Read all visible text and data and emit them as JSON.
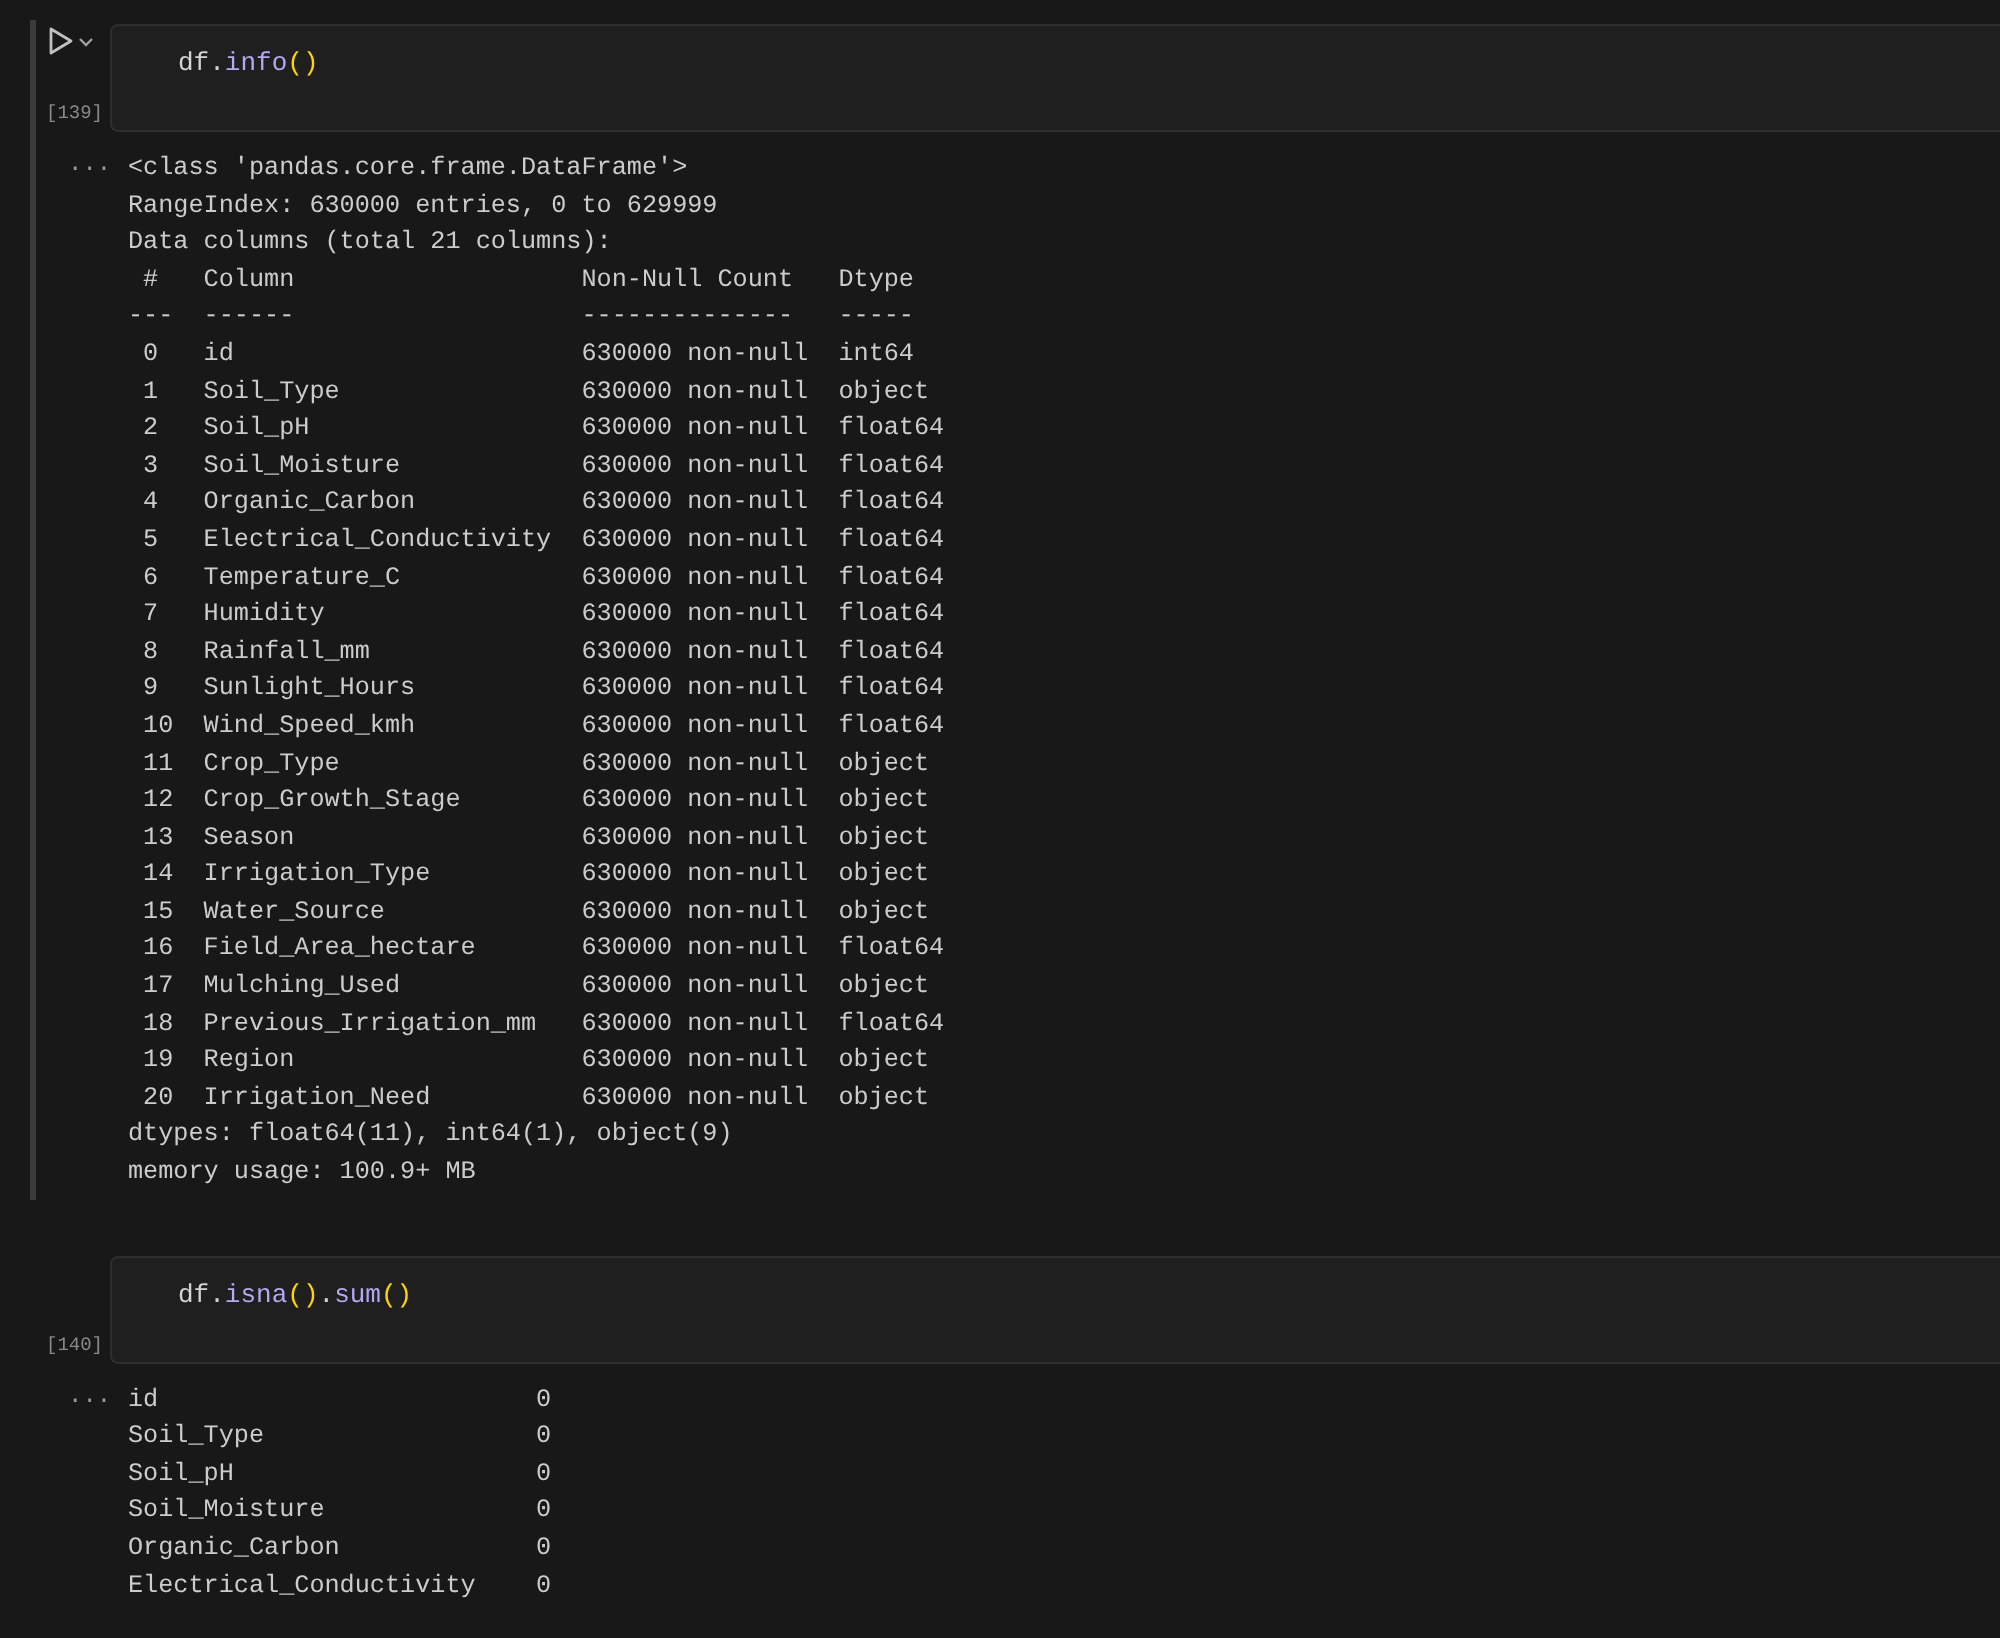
{
  "cells": [
    {
      "selected": true,
      "execution_count": "[139]",
      "code": [
        {
          "text": "df",
          "kind": "variable"
        },
        {
          "text": ".",
          "kind": "plain"
        },
        {
          "text": "info",
          "kind": "function"
        },
        {
          "text": "()",
          "kind": "bracket"
        }
      ],
      "output_marker": "...",
      "output": {
        "kind": "text",
        "lines": [
          "<class 'pandas.core.frame.DataFrame'>",
          "RangeIndex: 630000 entries, 0 to 629999",
          "Data columns (total 21 columns):",
          " #   Column                   Non-Null Count   Dtype  ",
          "---  ------                   --------------   -----  ",
          " 0   id                       630000 non-null  int64  ",
          " 1   Soil_Type                630000 non-null  object ",
          " 2   Soil_pH                  630000 non-null  float64",
          " 3   Soil_Moisture            630000 non-null  float64",
          " 4   Organic_Carbon           630000 non-null  float64",
          " 5   Electrical_Conductivity  630000 non-null  float64",
          " 6   Temperature_C            630000 non-null  float64",
          " 7   Humidity                 630000 non-null  float64",
          " 8   Rainfall_mm              630000 non-null  float64",
          " 9   Sunlight_Hours           630000 non-null  float64",
          " 10  Wind_Speed_kmh           630000 non-null  float64",
          " 11  Crop_Type                630000 non-null  object ",
          " 12  Crop_Growth_Stage        630000 non-null  object ",
          " 13  Season                   630000 non-null  object ",
          " 14  Irrigation_Type          630000 non-null  object ",
          " 15  Water_Source             630000 non-null  object ",
          " 16  Field_Area_hectare       630000 non-null  float64",
          " 17  Mulching_Used            630000 non-null  object ",
          " 18  Previous_Irrigation_mm   630000 non-null  float64",
          " 19  Region                   630000 non-null  object ",
          " 20  Irrigation_Need          630000 non-null  object ",
          "dtypes: float64(11), int64(1), object(9)",
          "memory usage: 100.9+ MB"
        ]
      }
    },
    {
      "selected": false,
      "execution_count": "[140]",
      "code": [
        {
          "text": "df",
          "kind": "variable"
        },
        {
          "text": ".",
          "kind": "plain"
        },
        {
          "text": "isna",
          "kind": "function"
        },
        {
          "text": "()",
          "kind": "bracket"
        },
        {
          "text": ".",
          "kind": "plain"
        },
        {
          "text": "sum",
          "kind": "function"
        },
        {
          "text": "()",
          "kind": "bracket"
        }
      ],
      "output_marker": "...",
      "output": {
        "kind": "series",
        "rows": [
          {
            "name": "id",
            "value": "0"
          },
          {
            "name": "Soil_Type",
            "value": "0"
          },
          {
            "name": "Soil_pH",
            "value": "0"
          },
          {
            "name": "Soil_Moisture",
            "value": "0"
          },
          {
            "name": "Organic_Carbon",
            "value": "0"
          },
          {
            "name": "Electrical_Conductivity",
            "value": "0"
          }
        ]
      }
    }
  ]
}
